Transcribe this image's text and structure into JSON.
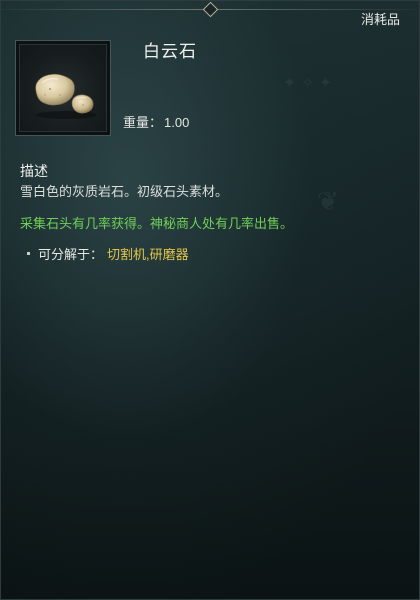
{
  "header": {
    "category": "消耗品"
  },
  "item": {
    "name": "白云石",
    "icon": "white-stone-icon",
    "weight_label": "重量：",
    "weight_value": "1.00"
  },
  "description": {
    "title": "描述",
    "text": "雪白色的灰质岩石。初级石头素材。",
    "source_text": "采集石头有几率获得。神秘商人处有几率出售。",
    "decompose_label": "可分解于：",
    "decompose_tools": "切割机,研磨器"
  },
  "colors": {
    "background": "#162628",
    "source_text": "#6fcf57",
    "tool_text": "#e2c64a",
    "text": "#e6e9e6"
  }
}
